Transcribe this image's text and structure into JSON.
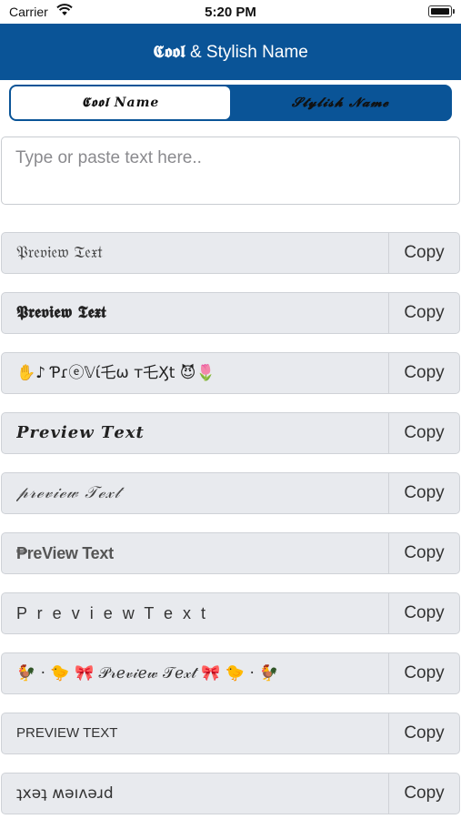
{
  "status_bar": {
    "carrier": "Carrier",
    "time": "5:20 PM"
  },
  "nav": {
    "title_fancy": "𝕮𝖔𝖔𝖑",
    "title_rest": " & Stylish Name"
  },
  "tabs": {
    "left": "𝕮𝖔𝖔𝖑 𝑵𝒂𝒎𝒆",
    "right": "𝓢𝓽𝔂𝓵𝓲𝓼𝓱 𝓝𝓪𝓶𝓮"
  },
  "input": {
    "placeholder": "Type or paste text here..",
    "value": ""
  },
  "copy_label": "Copy",
  "styles": [
    {
      "preview": "𝔓𝔯𝔢𝔳𝔦𝔢𝔴 𝔗𝔢𝔵𝔱"
    },
    {
      "preview": "𝕻𝖗𝖊𝖛𝖎𝖊𝖜 𝕿𝖊𝖝𝖙"
    },
    {
      "preview": "✋♪ Ƥɾⓔ𝕍ί乇ω т乇Ӽt 😈🌷"
    },
    {
      "preview": "𝑷𝒓𝒆𝒗𝒊𝒆𝒘 𝑻𝒆𝒙𝒕"
    },
    {
      "preview": "𝓅𝓇ℯ𝓋𝒾ℯ𝓌 𝒯ℯ𝓍𝓉"
    },
    {
      "preview": "₱reView Text"
    },
    {
      "preview": "P r e v i e w  T e x t"
    },
    {
      "preview": "🐓 · 🐤 🎀 𝒫𝓇ℯ𝓋𝒾ℯ𝓌 𝒯ℯ𝓍𝓉 🎀 🐤 · 🐓"
    },
    {
      "preview": "PREVIEW TEXT"
    },
    {
      "preview": "ʇxəʇ ʍəıʌəɹd"
    }
  ]
}
